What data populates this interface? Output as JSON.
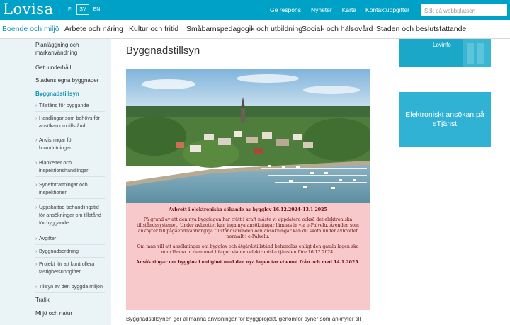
{
  "header": {
    "logo": "Lovisa",
    "languages": [
      {
        "code": "FI",
        "active": false
      },
      {
        "code": "SV",
        "active": true
      },
      {
        "code": "EN",
        "active": false
      }
    ],
    "links": [
      "Ge respons",
      "Nyheter",
      "Karta",
      "Kontaktuppgifter"
    ],
    "search_placeholder": "Sök på webbplatsen",
    "brand_color": "#00a1c6"
  },
  "mainnav": {
    "items": [
      "Boende och miljö",
      "Arbete och näring",
      "Kultur och fritid",
      "Småbarnspedagogik och utbildning",
      "Social- och hälsovård",
      "Staden och beslutsfattande"
    ],
    "active_index": 0
  },
  "sidebar": {
    "top_items": [
      "Planläggning och markanvändning",
      "Gatuunderhåll",
      "Stadens egna byggnader"
    ],
    "active_item": "Byggnadstillsyn",
    "sub_items": [
      "Tillstånd för byggande",
      "Handlingar som behövs för ansökan om tillstånd",
      "Anvisningar för huvudritningar",
      "Blanketter och inspektionshandlingar",
      "Syneförrättningar och inspektioner",
      "Uppskattad behandlingstid för ansökningar om tillstånd för byggande",
      "Avgifter",
      "Byggnadsordning",
      "Projekt för att kontrollera fastighetsuppgifter",
      "Tillsyn av den byggda miljön"
    ],
    "bottom_items": [
      "Trafik",
      "Miljö och natur"
    ]
  },
  "content": {
    "page_title": "Byggnadstillsyn",
    "notice": {
      "title": "Avbrott i elektroniska sökande av bygglov 16.12.2024–13.1.2025",
      "paragraph1": "På grund av att den nya bygglagen har trätt i kraft måste vi uppdatera också det elektroniska tillståndssystemet. Under avbrottet kan inga nya ansökningar lämnas in via e-Palvelu. Ärenden som anknyter till pågående/anhängiga tillståndsärenden och ansökningar kan du sköta under avbrottet normalt i e-Palvelu.",
      "paragraph2": "Om man vill att ansökningar om bygglov och åtgärdstillstånd behandlas enligt den gamla lagen ska man lämna in dem med bilagor via den elektroniska tjänsten före 16.12.2024.",
      "paragraph3": "Ansökningar om bygglov i enlighet med den nya lagen tar vi emot från och med 14.1.2025.",
      "bg_color": "#f8c9cb"
    },
    "intro_text": "Byggnadstillsynen ger allmänna anvisningar för byggprojekt, genomför syner som anknyter till"
  },
  "right": {
    "lovinfo_label": "Lovinfo",
    "eservice_label": "Elektroniskt ansökan på eTjänst",
    "eservice_color": "#2fb2d3"
  }
}
